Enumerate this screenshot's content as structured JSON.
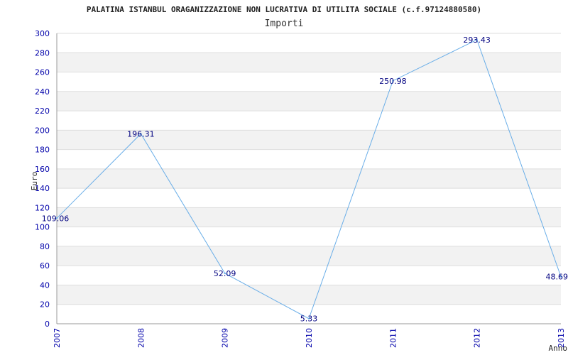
{
  "chart_data": {
    "type": "line",
    "title": "PALATINA ISTANBUL ORAGANIZZAZIONE NON LUCRATIVA DI UTILITA SOCIALE (c.f.97124880580)",
    "subtitle": "Importi",
    "xlabel": "Anno",
    "ylabel": "Euro",
    "categories": [
      "2007",
      "2008",
      "2009",
      "2010",
      "2011",
      "2012",
      "2013"
    ],
    "series": [
      {
        "values": [
          109.06,
          196.31,
          52.09,
          5.33,
          250.98,
          293.43,
          48.69
        ]
      }
    ],
    "value_labels": [
      "109.06",
      "196.31",
      "52.09",
      "5.33",
      "250.98",
      "293.43",
      "48.69"
    ],
    "yticks": [
      "0",
      "20",
      "40",
      "60",
      "80",
      "100",
      "120",
      "140",
      "160",
      "180",
      "200",
      "220",
      "240",
      "260",
      "280",
      "300"
    ],
    "ylim": [
      0,
      300
    ],
    "grid": true,
    "legend": "none",
    "colors": {
      "line": "#6aaee8",
      "band": "#f2f2f2",
      "grid": "#dddddd",
      "tick_text": "#0000aa",
      "label_text": "#000080"
    }
  }
}
